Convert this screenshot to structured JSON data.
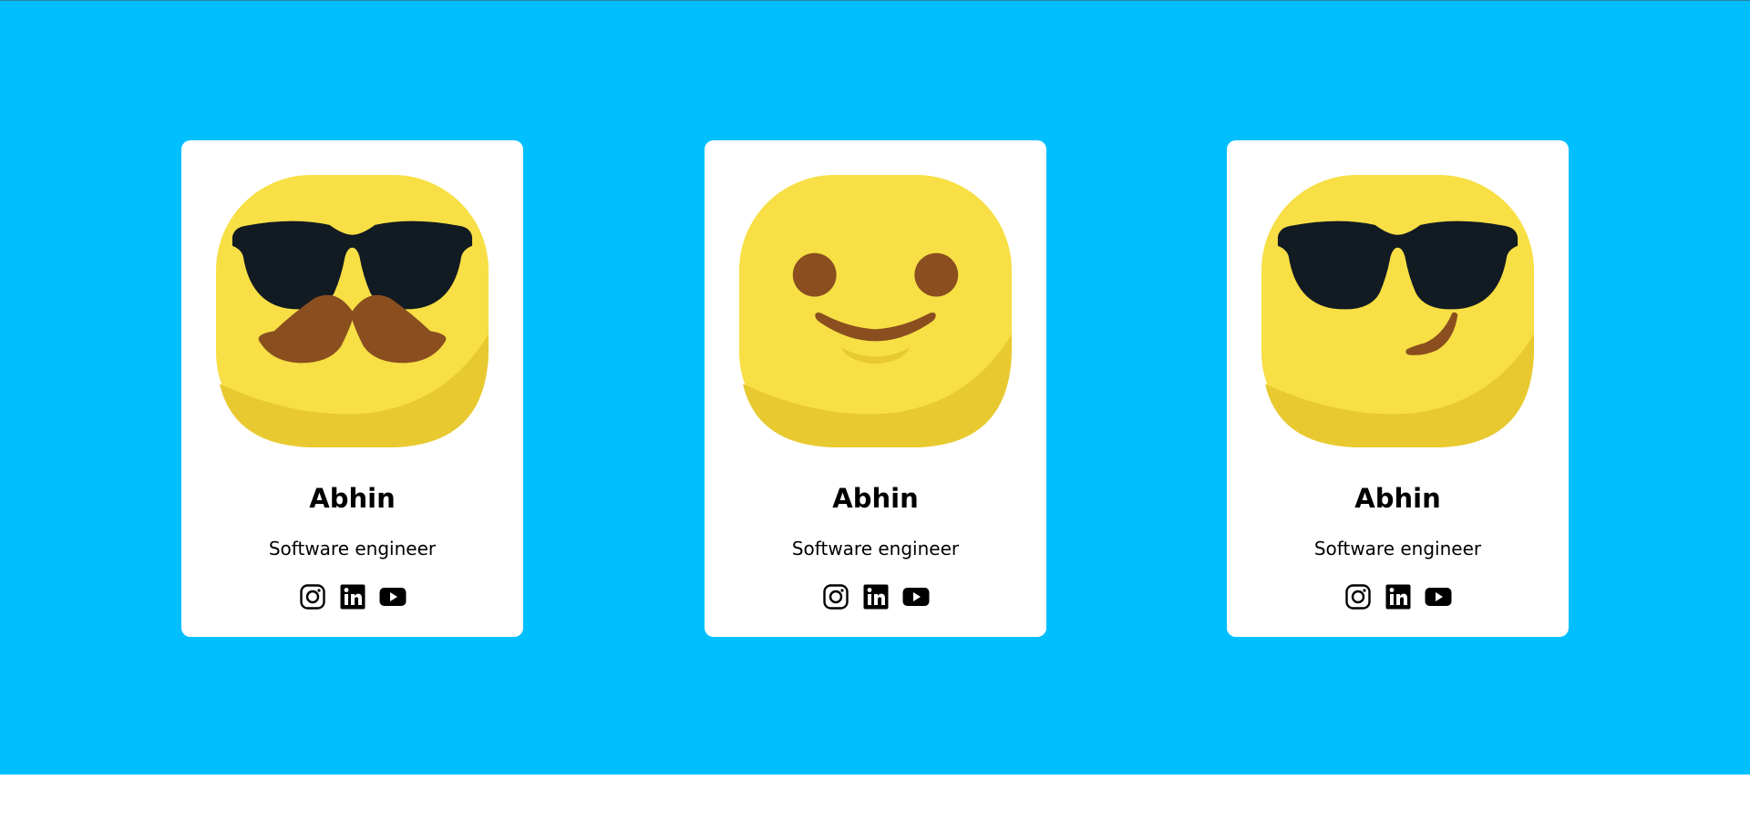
{
  "colors": {
    "background": "#00bfff",
    "card": "#ffffff",
    "face": "#f7df45",
    "face_shade": "#e8c930",
    "glasses": "#121a22",
    "brown": "#8a4e1f"
  },
  "cards": [
    {
      "avatar": "emoji-sunglasses-mustache-icon",
      "name": "Abhin",
      "role": "Software engineer",
      "socials": [
        "instagram-icon",
        "linkedin-icon",
        "youtube-icon"
      ]
    },
    {
      "avatar": "emoji-smile-icon",
      "name": "Abhin",
      "role": "Software engineer",
      "socials": [
        "instagram-icon",
        "linkedin-icon",
        "youtube-icon"
      ]
    },
    {
      "avatar": "emoji-sunglasses-smirk-icon",
      "name": "Abhin",
      "role": "Software engineer",
      "socials": [
        "instagram-icon",
        "linkedin-icon",
        "youtube-icon"
      ]
    }
  ]
}
